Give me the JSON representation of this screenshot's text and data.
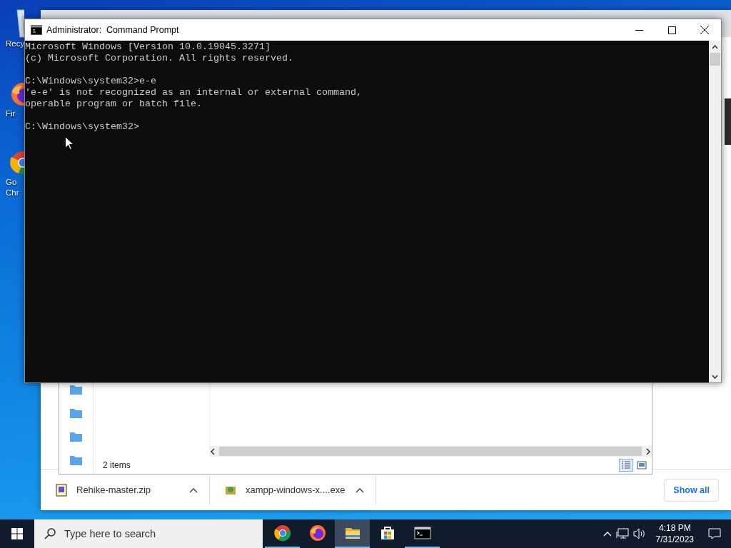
{
  "desktop_icons": [
    {
      "kind": "recycle",
      "label_lines": [
        "Recy"
      ]
    },
    {
      "kind": "firefox",
      "label_lines": [
        "Fir"
      ]
    },
    {
      "kind": "chrome",
      "label_lines": [
        "Go",
        "Chr"
      ]
    }
  ],
  "browser": {
    "downloads": [
      {
        "kind": "zip",
        "name": "Rehike-master.zip"
      },
      {
        "kind": "installer",
        "name": "xampp-windows-x....exe"
      }
    ],
    "show_all": "Show all"
  },
  "explorer": {
    "status": "2 items",
    "views": [
      {
        "kind": "details",
        "selected": true
      },
      {
        "kind": "preview",
        "selected": false
      }
    ]
  },
  "cmd": {
    "title": "Administrator:  Command Prompt",
    "blocks": [
      [
        "Microsoft Windows [Version 10.0.19045.3271]",
        "(c) Microsoft Corporation. All rights reserved."
      ],
      [
        "C:\\Windows\\system32>e-e",
        "'e-e' is not recognized as an internal or external command,",
        "operable program or batch file."
      ],
      [
        "C:\\Windows\\system32>"
      ]
    ]
  },
  "taskbar": {
    "search": {
      "placeholder": "Type here to search"
    },
    "apps": [
      {
        "kind": "chrome",
        "running": true,
        "selected": false
      },
      {
        "kind": "firefox",
        "running": false,
        "selected": false
      },
      {
        "kind": "explorer",
        "running": true,
        "selected": true
      },
      {
        "kind": "store",
        "running": false,
        "selected": false
      },
      {
        "kind": "cmd",
        "running": true,
        "selected": false
      }
    ],
    "time": "4:18 PM",
    "date": "7/31/2023"
  }
}
